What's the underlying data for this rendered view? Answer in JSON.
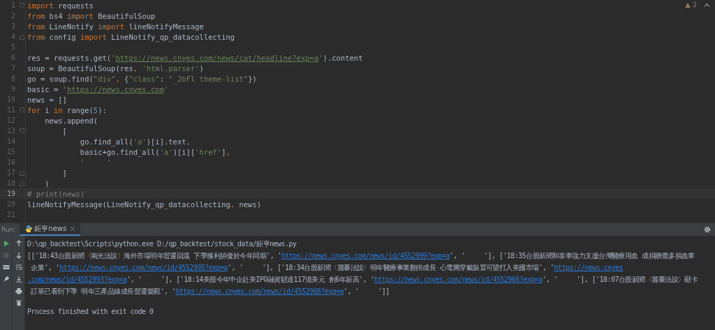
{
  "editor": {
    "inspection": {
      "count": "2"
    },
    "lines": [
      {
        "number": "1",
        "selected": false,
        "fold_start": true,
        "fold_end": false,
        "tokens": [
          {
            "kind": "keyword",
            "text": "import"
          },
          {
            "kind": "plain",
            "text": " requests"
          }
        ]
      },
      {
        "number": "2",
        "selected": false,
        "fold_start": false,
        "fold_end": false,
        "tokens": [
          {
            "kind": "keyword",
            "text": "from"
          },
          {
            "kind": "plain",
            "text": " bs4 "
          },
          {
            "kind": "keyword",
            "text": "import"
          },
          {
            "kind": "plain",
            "text": " BeautifulSoup"
          }
        ]
      },
      {
        "number": "3",
        "selected": false,
        "fold_start": false,
        "fold_end": false,
        "tokens": [
          {
            "kind": "keyword",
            "text": "from"
          },
          {
            "kind": "plain",
            "text": " LineNotify "
          },
          {
            "kind": "keyword",
            "text": "import"
          },
          {
            "kind": "plain",
            "text": " lineNotifyMessage"
          }
        ]
      },
      {
        "number": "4",
        "selected": false,
        "fold_start": false,
        "fold_end": true,
        "tokens": [
          {
            "kind": "keyword",
            "text": "from"
          },
          {
            "kind": "plain",
            "text": " config "
          },
          {
            "kind": "keyword",
            "text": "import"
          },
          {
            "kind": "plain",
            "text": " LineNotify_qp_datacollecting"
          }
        ]
      },
      {
        "number": "5",
        "selected": false,
        "fold_start": false,
        "fold_end": false
      },
      {
        "number": "6",
        "selected": false,
        "fold_start": false,
        "fold_end": false,
        "tokens": [
          {
            "kind": "plain",
            "text": "res = requests.get("
          },
          {
            "kind": "string",
            "text": "'"
          },
          {
            "kind": "link",
            "text": "https://news.cnyes.com/news/cat/headline?exp=a"
          },
          {
            "kind": "string",
            "text": "'"
          },
          {
            "kind": "plain",
            "text": ").content"
          }
        ]
      },
      {
        "number": "7",
        "selected": false,
        "fold_start": false,
        "fold_end": false,
        "tokens": [
          {
            "kind": "plain",
            "text": "soup = BeautifulSoup(res"
          },
          {
            "kind": "punct",
            "text": ", "
          },
          {
            "kind": "string",
            "text": "'html.parser'"
          },
          {
            "kind": "plain",
            "text": ")"
          }
        ]
      },
      {
        "number": "8",
        "selected": false,
        "fold_start": false,
        "fold_end": false,
        "tokens": [
          {
            "kind": "plain",
            "text": "go = soup.find("
          },
          {
            "kind": "string",
            "text": "\"div\""
          },
          {
            "kind": "punct",
            "text": ","
          },
          {
            "kind": "plain",
            "text": " {"
          },
          {
            "kind": "string",
            "text": "\"class\""
          },
          {
            "kind": "plain",
            "text": ": "
          },
          {
            "kind": "string",
            "text": "\"_2bFl theme-list\""
          },
          {
            "kind": "plain",
            "text": "})"
          }
        ]
      },
      {
        "number": "9",
        "selected": false,
        "fold_start": false,
        "fold_end": false,
        "tokens": [
          {
            "kind": "plain",
            "text": "basic = "
          },
          {
            "kind": "string",
            "text": "'"
          },
          {
            "kind": "link",
            "text": "https://news.cnyes.com"
          },
          {
            "kind": "string",
            "text": "'"
          }
        ]
      },
      {
        "number": "10",
        "selected": false,
        "fold_start": false,
        "fold_end": false,
        "tokens": [
          {
            "kind": "plain",
            "text": "news = []"
          }
        ]
      },
      {
        "number": "11",
        "selected": false,
        "fold_start": true,
        "fold_end": false,
        "tokens": [
          {
            "kind": "keyword",
            "text": "for"
          },
          {
            "kind": "plain",
            "text": " i "
          },
          {
            "kind": "keyword",
            "text": "in"
          },
          {
            "kind": "plain",
            "text": " range("
          },
          {
            "kind": "number",
            "text": "5"
          },
          {
            "kind": "plain",
            "text": "):"
          }
        ]
      },
      {
        "number": "12",
        "selected": false,
        "fold_start": false,
        "fold_end": false,
        "tokens": [
          {
            "kind": "plain",
            "text": "    news.append("
          }
        ]
      },
      {
        "number": "13",
        "selected": false,
        "fold_start": true,
        "fold_end": false,
        "tokens": [
          {
            "kind": "plain",
            "text": "        ["
          }
        ]
      },
      {
        "number": "14",
        "selected": false,
        "fold_start": false,
        "fold_end": false,
        "tokens": [
          {
            "kind": "plain",
            "text": "            go.find_all("
          },
          {
            "kind": "string",
            "text": "'a'"
          },
          {
            "kind": "plain",
            "text": ")[i].text"
          },
          {
            "kind": "punct",
            "text": ","
          }
        ]
      },
      {
        "number": "15",
        "selected": false,
        "fold_start": false,
        "fold_end": false,
        "tokens": [
          {
            "kind": "plain",
            "text": "            basic+go.find_all("
          },
          {
            "kind": "string",
            "text": "'a'"
          },
          {
            "kind": "plain",
            "text": ")[i]["
          },
          {
            "kind": "string",
            "text": "'href'"
          },
          {
            "kind": "plain",
            "text": "]"
          },
          {
            "kind": "punct",
            "text": ","
          }
        ]
      },
      {
        "number": "16",
        "selected": false,
        "fold_start": false,
        "fold_end": false,
        "tokens": [
          {
            "kind": "string",
            "text": "            '     '"
          }
        ]
      },
      {
        "number": "17",
        "selected": false,
        "fold_start": false,
        "fold_end": true,
        "tokens": [
          {
            "kind": "plain",
            "text": "        ]"
          }
        ]
      },
      {
        "number": "18",
        "selected": false,
        "fold_start": false,
        "fold_end": true,
        "tokens": [
          {
            "kind": "plain",
            "text": "    )"
          }
        ]
      },
      {
        "number": "19",
        "selected": true,
        "fold_start": false,
        "fold_end": false,
        "tokens": [
          {
            "kind": "comment",
            "text": "# print(news)"
          }
        ]
      },
      {
        "number": "20",
        "selected": false,
        "fold_start": false,
        "fold_end": false,
        "tokens": [
          {
            "kind": "plain",
            "text": "lineNotifyMessage(LineNotify_qp_datacollecting"
          },
          {
            "kind": "punct",
            "text": ","
          },
          {
            "kind": "plain",
            "text": " news)"
          }
        ]
      },
      {
        "number": "21",
        "selected": false,
        "fold_start": false,
        "fold_end": false
      }
    ]
  },
  "run_panel": {
    "label": "Run:",
    "tab": "鉅亨news",
    "console": [
      [
        {
          "kind": "text",
          "text": "D:\\qp_backtest\\Scripts\\python.exe D:/qp_backtest/stock_data/鉅亨news.py"
        }
      ],
      [
        {
          "kind": "text",
          "text": "[['18:43台股新聞〈南光法說〉海外市場明年營運回溫 下季獲利拚優於今年同期', '"
        },
        {
          "kind": "link",
          "text": "https://news.cnyes.com/news/id/4552999?exp=a"
        },
        {
          "kind": "text",
          "text": "', '     '], ['18:35台股新聞和泰車強力支援台灣醫療用血 成捐贈最多捐血車"
        }
      ],
      [
        {
          "kind": "text",
          "text": " 企業', '"
        },
        {
          "kind": "link",
          "text": "https://news.cnyes.com/news/id/4552995?exp=a"
        },
        {
          "kind": "text",
          "text": "', '     '], ['18:34台股新聞〈麗臺法說〉明年醫療事業翻倍成長 心電圖穿戴裝置可望打入美國市場', '"
        },
        {
          "kind": "link",
          "text": "https://news.cnyes"
        }
      ],
      [
        {
          "kind": "link",
          "text": ".com/news/id/4552993?exp=a"
        },
        {
          "kind": "text",
          "text": "', '     '], ['18:14美股今年中企赴美IPO融資額達117億美元 創6年新高', '"
        },
        {
          "kind": "link",
          "text": "https://news.cnyes.com/news/id/4552966?exp=a"
        },
        {
          "kind": "text",
          "text": "', '     '], ['18:07台股新聞〈麗臺法說〉顯卡"
        }
      ],
      [
        {
          "kind": "text",
          "text": " 訂單已看到下季 明年三產品線成長營運樂觀', '"
        },
        {
          "kind": "link",
          "text": "https://news.cnyes.com/news/id/4552988?exp=a"
        },
        {
          "kind": "text",
          "text": "', '     ']]"
        }
      ],
      [
        {
          "kind": "text",
          "text": "Process finished with exit code 0"
        }
      ]
    ]
  }
}
